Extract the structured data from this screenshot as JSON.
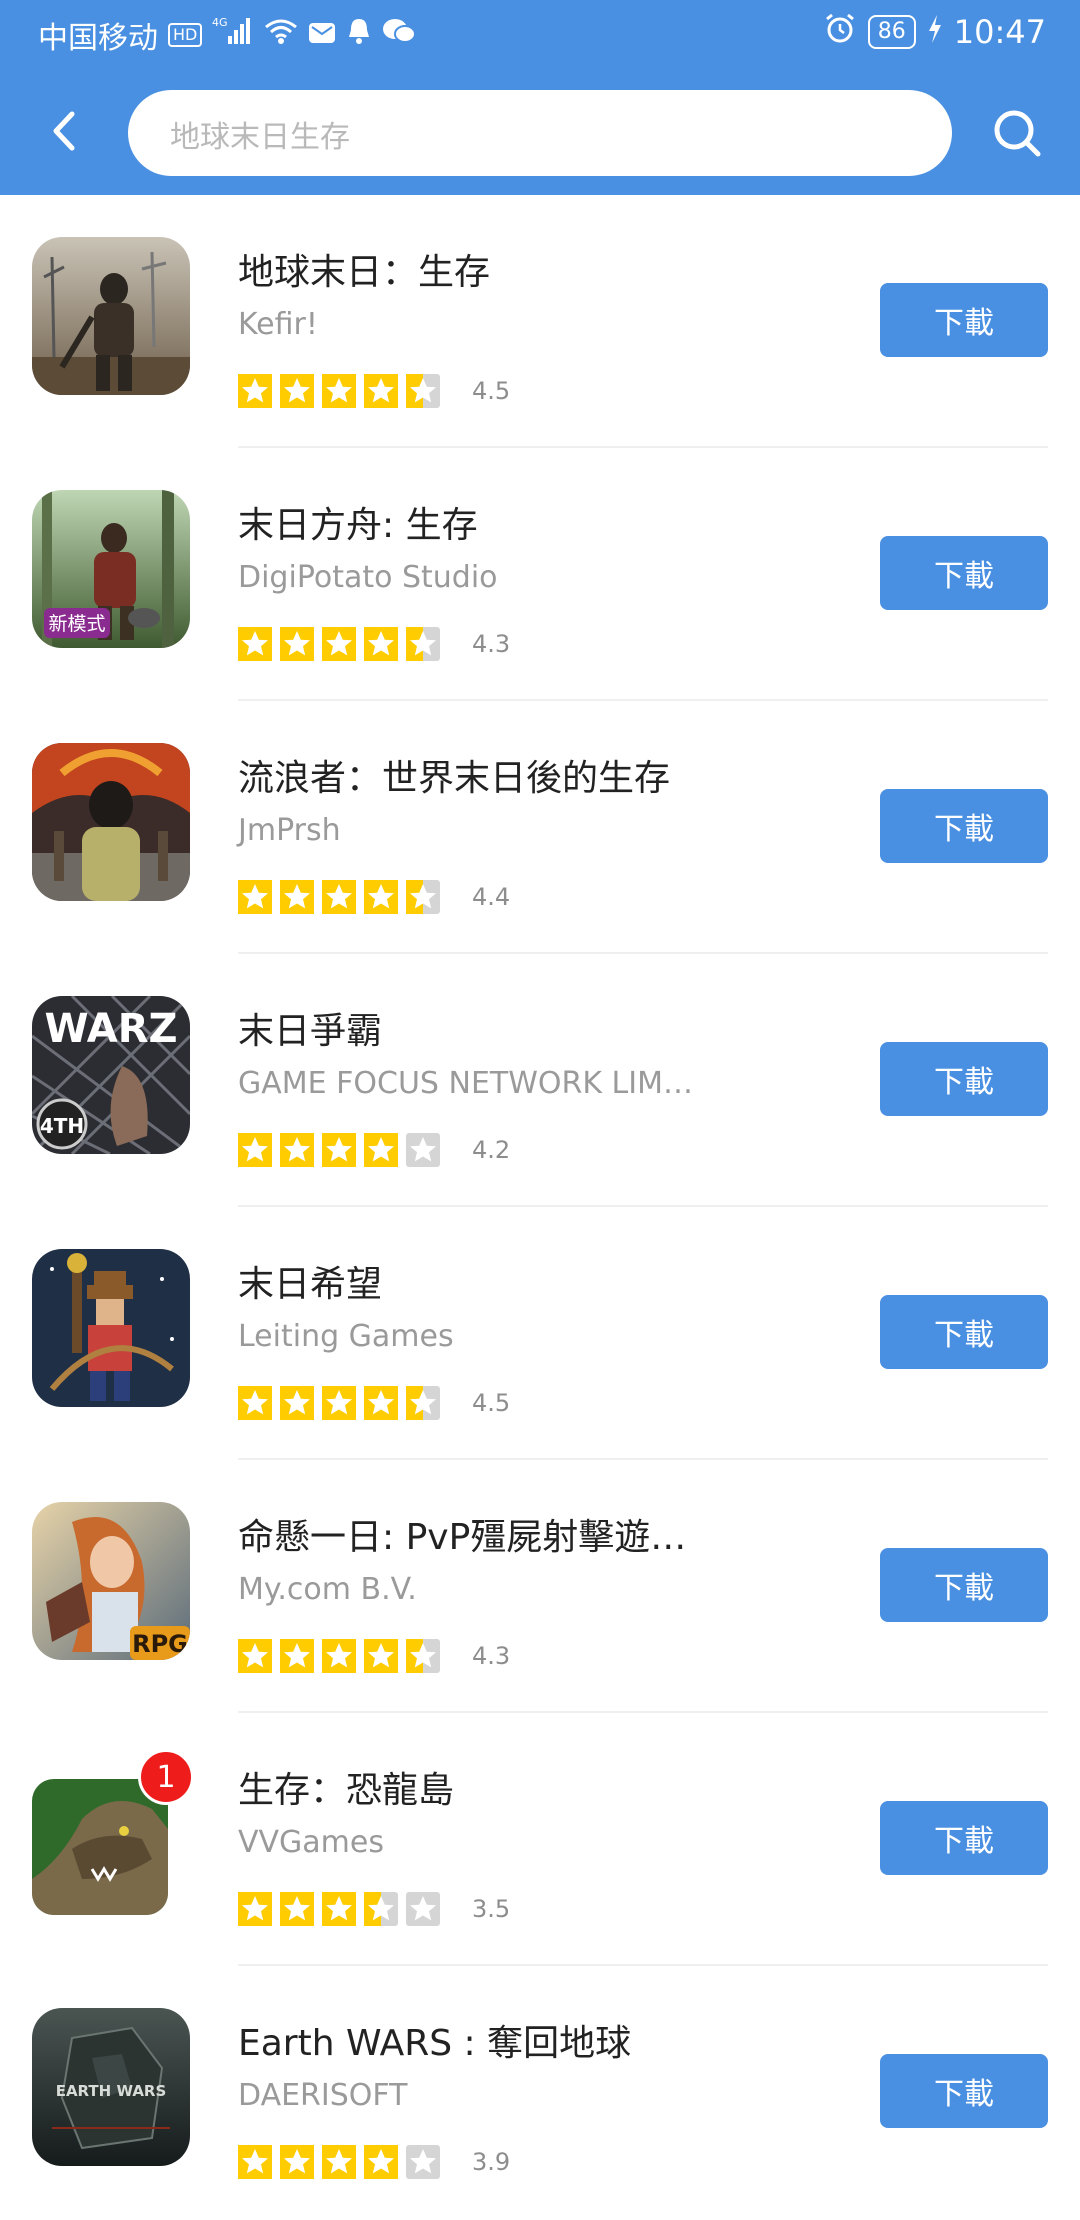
{
  "status": {
    "carrier": "中国移动",
    "hd": "HD",
    "network": "4G",
    "battery": "86",
    "time": "10:47"
  },
  "search": {
    "placeholder": "地球末日生存"
  },
  "colors": {
    "primary": "#4a90e2",
    "star": "#ffcc00",
    "star_empty": "#d5d5d5",
    "badge": "#ef1c1c"
  },
  "apps": [
    {
      "title": "地球末日：生存",
      "developer": "Kefir!",
      "rating": "4.5",
      "stars": 4.5,
      "button": "下載",
      "icon": "doomsday-survivor-icon"
    },
    {
      "title": "末日方舟: 生存",
      "developer": "DigiPotato Studio",
      "rating": "4.3",
      "stars": 4.5,
      "button": "下載",
      "icon": "ark-survivor-icon",
      "icon_label": "新模式"
    },
    {
      "title": "流浪者：世界末日後的生存",
      "developer": "JmPrsh",
      "rating": "4.4",
      "stars": 4.5,
      "button": "下載",
      "icon": "wanderer-icon"
    },
    {
      "title": "末日爭霸",
      "developer": "GAME FOCUS NETWORK LIM…",
      "rating": "4.2",
      "stars": 4,
      "button": "下載",
      "icon": "warz-icon",
      "icon_label": "WARZ",
      "icon_sub": "4TH"
    },
    {
      "title": "末日希望",
      "developer": "Leiting Games",
      "rating": "4.5",
      "stars": 4.5,
      "button": "下載",
      "icon": "archer-icon"
    },
    {
      "title": "命懸一日: PvP殭屍射擊遊…",
      "developer": "My.com B.V.",
      "rating": "4.3",
      "stars": 4.5,
      "button": "下載",
      "icon": "heroine-icon",
      "icon_label": "RPG"
    },
    {
      "title": "生存：恐龍島",
      "developer": "VVGames",
      "rating": "3.5",
      "stars": 3.5,
      "button": "下載",
      "icon": "dinosaur-icon",
      "badge": "1"
    },
    {
      "title": "Earth WARS : 奪回地球",
      "developer": "DAERISOFT",
      "rating": "3.9",
      "stars": 4,
      "button": "下載",
      "icon": "earth-wars-icon",
      "icon_label": "EARTH WARS"
    }
  ]
}
